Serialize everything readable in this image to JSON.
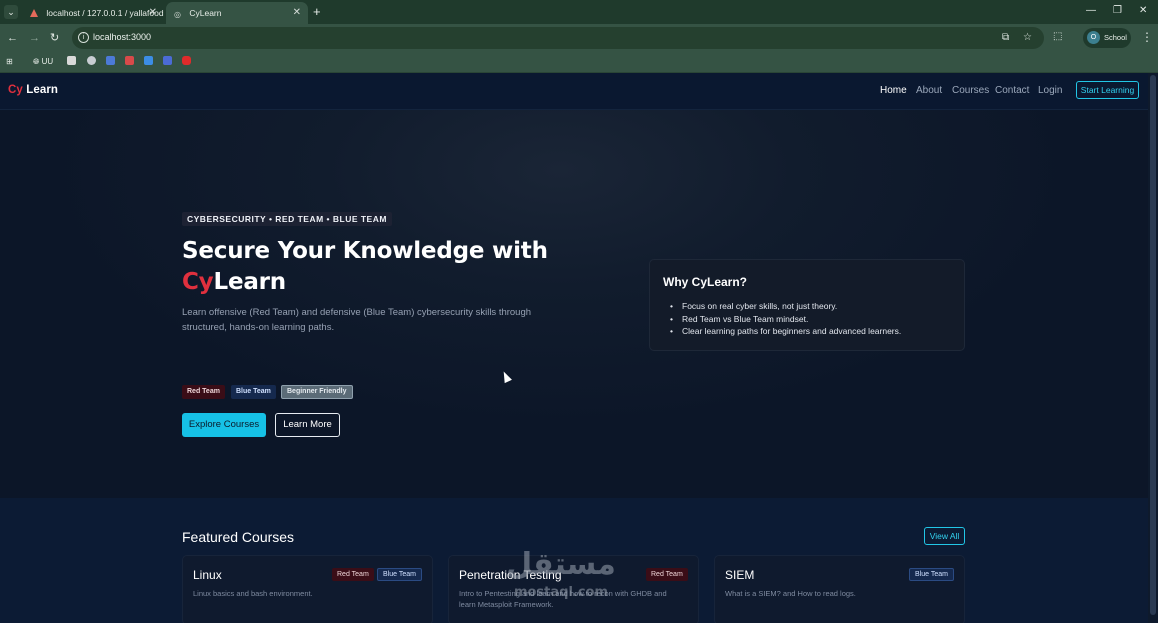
{
  "browser": {
    "tabs": [
      {
        "title": "localhost / 127.0.0.1 / yallafood",
        "active": false
      },
      {
        "title": "CyLearn",
        "active": true
      }
    ],
    "url": "localhost:3000",
    "bookmarks": [
      "UU"
    ],
    "profile_label": "School",
    "profile_initial": "O"
  },
  "site": {
    "logo_cy": "Cy",
    "logo_rest": "Learn",
    "nav": [
      "Home",
      "About",
      "Courses",
      "Contact",
      "Login"
    ],
    "cta": "Start Learning"
  },
  "hero": {
    "kicker": "CYBERSECURITY • RED TEAM • BLUE TEAM",
    "title_line1": "Secure Your Knowledge with",
    "title_cy": "Cy",
    "title_rest": "Learn",
    "subtitle": "Learn offensive (Red Team) and defensive (Blue Team) cybersecurity skills through structured, hands-on learning paths.",
    "pills": [
      "Red Team",
      "Blue Team",
      "Beginner Friendly"
    ],
    "primary_button": "Explore Courses",
    "secondary_button": "Learn More"
  },
  "why": {
    "title": "Why CyLearn?",
    "points": [
      "Focus on real cyber skills, not just theory.",
      "Red Team vs Blue Team mindset.",
      "Clear learning paths for beginners and advanced learners."
    ]
  },
  "featured": {
    "title": "Featured Courses",
    "view_all": "View All",
    "courses": [
      {
        "title": "Linux",
        "tags": [
          "Red Team",
          "Blue Team"
        ],
        "description": "Linux basics and bash environment."
      },
      {
        "title": "Penetration Testing",
        "tags": [
          "Red Team"
        ],
        "description": "Intro to Pentesting and learn and how to recon with GHDB and learn Metasploit Framework."
      },
      {
        "title": "SIEM",
        "tags": [
          "Blue Team"
        ],
        "description": "What is a SIEM? and How to read logs."
      }
    ]
  },
  "watermark": {
    "text_ar": "مستقل",
    "text_en": "mostaql.com"
  }
}
